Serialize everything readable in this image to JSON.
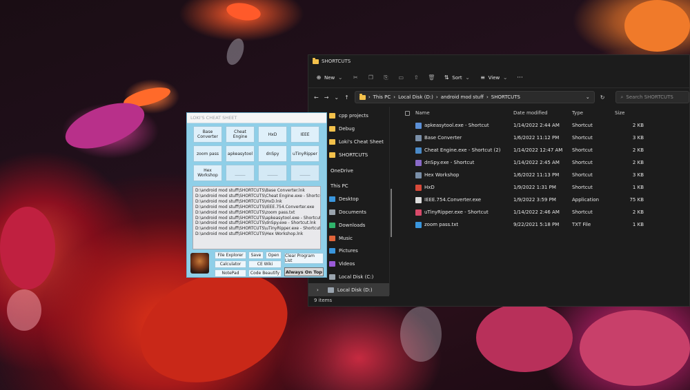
{
  "explorer": {
    "title": "SHORTCUTS",
    "toolbar": {
      "new_label": "New",
      "sort_label": "Sort",
      "view_label": "View",
      "more_label": "···"
    },
    "address": {
      "path": [
        "This PC",
        "Local Disk (D:)",
        "android mod stuff",
        "SHORTCUTS"
      ]
    },
    "search": {
      "placeholder": "Search SHORTCUTS"
    },
    "nav": [
      {
        "label": "cpp projects",
        "icon": "folder-icon",
        "color": "#f3c14b"
      },
      {
        "label": "Debug",
        "icon": "folder-icon",
        "color": "#f3c14b"
      },
      {
        "label": "Loki's Cheat Sheet",
        "icon": "folder-icon",
        "color": "#f3c14b"
      },
      {
        "label": "SHORTCUTS",
        "icon": "folder-icon",
        "color": "#f3c14b"
      },
      {
        "label": "OneDrive",
        "icon": "cloud-icon",
        "color": "#3a96dd"
      },
      {
        "label": "This PC",
        "icon": "computer-icon",
        "color": "#3a96dd"
      },
      {
        "label": "Desktop",
        "icon": "desktop-icon",
        "color": "#3a96dd"
      },
      {
        "label": "Documents",
        "icon": "documents-icon",
        "color": "#9aa4ae"
      },
      {
        "label": "Downloads",
        "icon": "downloads-icon",
        "color": "#2fb36b"
      },
      {
        "label": "Music",
        "icon": "music-icon",
        "color": "#e0643a"
      },
      {
        "label": "Pictures",
        "icon": "pictures-icon",
        "color": "#3a96dd"
      },
      {
        "label": "Videos",
        "icon": "videos-icon",
        "color": "#9a5ad8"
      },
      {
        "label": "Local Disk (C:)",
        "icon": "drive-icon",
        "color": "#9aa4ae"
      },
      {
        "label": "Local Disk (D:)",
        "icon": "drive-icon",
        "color": "#9aa4ae"
      }
    ],
    "columns": {
      "name": "Name",
      "date": "Date modified",
      "type": "Type",
      "size": "Size"
    },
    "files": [
      {
        "name": "apkeasytool.exe - Shortcut",
        "date": "1/14/2022 2:44 AM",
        "type": "Shortcut",
        "size": "2 KB",
        "icon": "shortcut-icon",
        "color": "#5b8fd6"
      },
      {
        "name": "Base Converter",
        "date": "1/6/2022 11:12 PM",
        "type": "Shortcut",
        "size": "3 KB",
        "icon": "app-icon",
        "color": "#7a8fa8"
      },
      {
        "name": "Cheat Engine.exe - Shortcut (2)",
        "date": "1/14/2022 12:47 AM",
        "type": "Shortcut",
        "size": "2 KB",
        "icon": "cheat-engine-icon",
        "color": "#4a8ac8"
      },
      {
        "name": "dnSpy.exe - Shortcut",
        "date": "1/14/2022 2:45 AM",
        "type": "Shortcut",
        "size": "2 KB",
        "icon": "shortcut-icon",
        "color": "#8a6ac8"
      },
      {
        "name": "Hex Workshop",
        "date": "1/6/2022 11:13 PM",
        "type": "Shortcut",
        "size": "3 KB",
        "icon": "app-icon",
        "color": "#7a8fa8"
      },
      {
        "name": "HxD",
        "date": "1/9/2022 1:31 PM",
        "type": "Shortcut",
        "size": "1 KB",
        "icon": "hxd-icon",
        "color": "#d84a3a"
      },
      {
        "name": "IEEE.754.Converter.exe",
        "date": "1/9/2022 3:59 PM",
        "type": "Application",
        "size": "75 KB",
        "icon": "exe-icon",
        "color": "#dcdcdc"
      },
      {
        "name": "uTinyRipper.exe - Shortcut",
        "date": "1/14/2022 2:46 AM",
        "type": "Shortcut",
        "size": "2 KB",
        "icon": "shortcut-icon",
        "color": "#d84a6a"
      },
      {
        "name": "zoom pass.txt",
        "date": "9/22/2021 5:18 PM",
        "type": "TXT File",
        "size": "1 KB",
        "icon": "text-file-icon",
        "color": "#3a96dd"
      }
    ],
    "status": "9 items"
  },
  "loki": {
    "title": "LOKI'S CHEAT SHEET",
    "buttons": [
      "Base Converter",
      "Cheat Engine",
      "HxD",
      "IEEE",
      "zoom pass",
      "apkeasytool",
      "dnSpy",
      "uTinyRipper",
      "Hex Workshop",
      "_____",
      "_____",
      "_____"
    ],
    "list": [
      "D:\\android mod stuff\\SHORTCUTS\\Base Converter.lnk",
      "D:\\android mod stuff\\SHORTCUTS\\Cheat Engine.exe - Shortcut (",
      "D:\\android mod stuff\\SHORTCUTS\\HxD.lnk",
      "D:\\android mod stuff\\SHORTCUTS\\IEEE.754.Converter.exe",
      "D:\\android mod stuff\\SHORTCUTS\\zoom pass.txt",
      "D:\\android mod stuff\\SHORTCUTS\\apkeasytool.exe - Shortcut.lnk",
      "D:\\android mod stuff\\SHORTCUTS\\dnSpy.exe - Shortcut.lnk",
      "D:\\android mod stuff\\SHORTCUTS\\uTinyRipper.exe - Shortcut.lnl",
      "D:\\android mod stuff\\SHORTCUTS\\Hex Workshop.lnk"
    ],
    "bottom": {
      "file_explorer": "File Explorer",
      "save": "Save",
      "open": "Open",
      "calculator": "Calculator",
      "ce_wiki": "CE Wiki",
      "notepad": "NotePad",
      "code_beautify": "Code Beautify",
      "clear": "Clear Program List",
      "always_on_top": "Always On Top"
    }
  }
}
